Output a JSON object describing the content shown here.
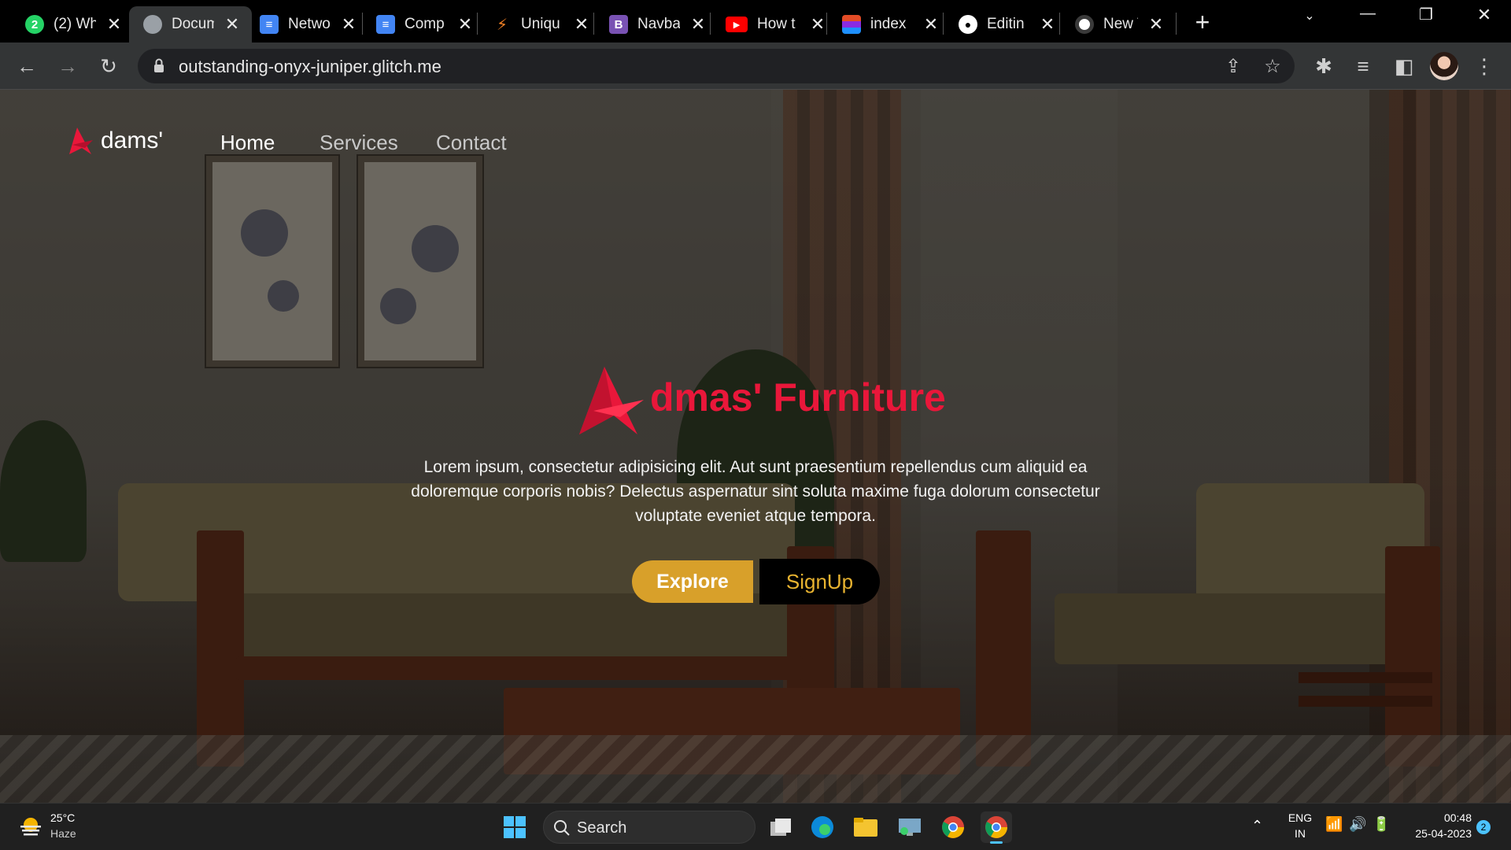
{
  "browser": {
    "tabs": [
      {
        "title": "(2) Wh",
        "favicon": "whatsapp-icon",
        "color": "#25d366"
      },
      {
        "title": "Docum",
        "favicon": "globe-icon",
        "color": "#9aa0a6"
      },
      {
        "title": "Netwo",
        "favicon": "docs-icon",
        "color": "#4285f4"
      },
      {
        "title": "Comp",
        "favicon": "docs-icon",
        "color": "#4285f4"
      },
      {
        "title": "Uniqu",
        "favicon": "stack-icon",
        "color": "#f48024"
      },
      {
        "title": "Navba",
        "favicon": "bootstrap-icon",
        "color": "#7952b3"
      },
      {
        "title": "How t",
        "favicon": "youtube-icon",
        "color": "#ff0000"
      },
      {
        "title": "index",
        "favicon": "page-icon",
        "color": "#e34c26"
      },
      {
        "title": "Editin",
        "favicon": "github-icon",
        "color": "#ffffff"
      },
      {
        "title": "New T",
        "favicon": "chrome-icon",
        "color": "#ffffff"
      }
    ],
    "url": "outstanding-onyx-juniper.glitch.me"
  },
  "site": {
    "brand": "dams'",
    "nav": [
      "Home",
      "Services",
      "Contact"
    ],
    "hero_title": "dmas' Furniture",
    "hero_description": "Lorem ipsum, consectetur adipisicing elit. Aut sunt praesentium repellendus cum aliquid ea doloremque corporis nobis? Delectus aspernatur sint soluta maxime fuga dolorum consectetur voluptate eveniet atque tempora.",
    "explore_label": "Explore",
    "signup_label": "SignUp",
    "accent_color": "#e9173a",
    "explore_color": "#d8a02a"
  },
  "taskbar": {
    "temperature": "25°C",
    "weather": "Haze",
    "search_label": "Search",
    "language": "ENG",
    "region": "IN",
    "time": "00:48",
    "date": "25-04-2023",
    "notifications": "2"
  }
}
